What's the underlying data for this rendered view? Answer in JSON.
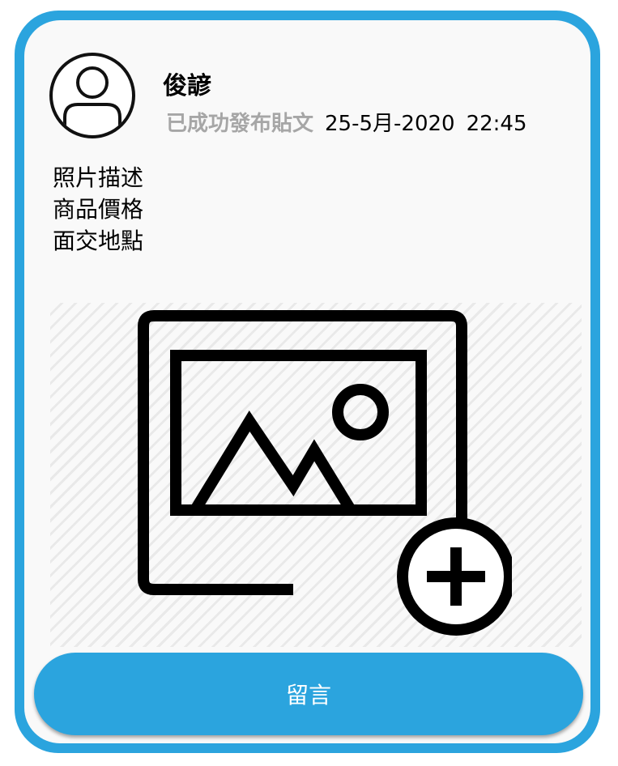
{
  "post": {
    "username": "俊諺",
    "status": "已成功發布貼文",
    "date": "25-5月-2020",
    "time": "22:45",
    "details": [
      "照片描述",
      "商品價格",
      "面交地點"
    ]
  },
  "icons": {
    "avatar": "user-avatar-icon",
    "photo": "add-photo-icon"
  },
  "actions": {
    "comment_label": "留言"
  },
  "colors": {
    "accent": "#2ba4de",
    "card_background": "#f9f9f9",
    "status_text": "#a6a6a6"
  }
}
